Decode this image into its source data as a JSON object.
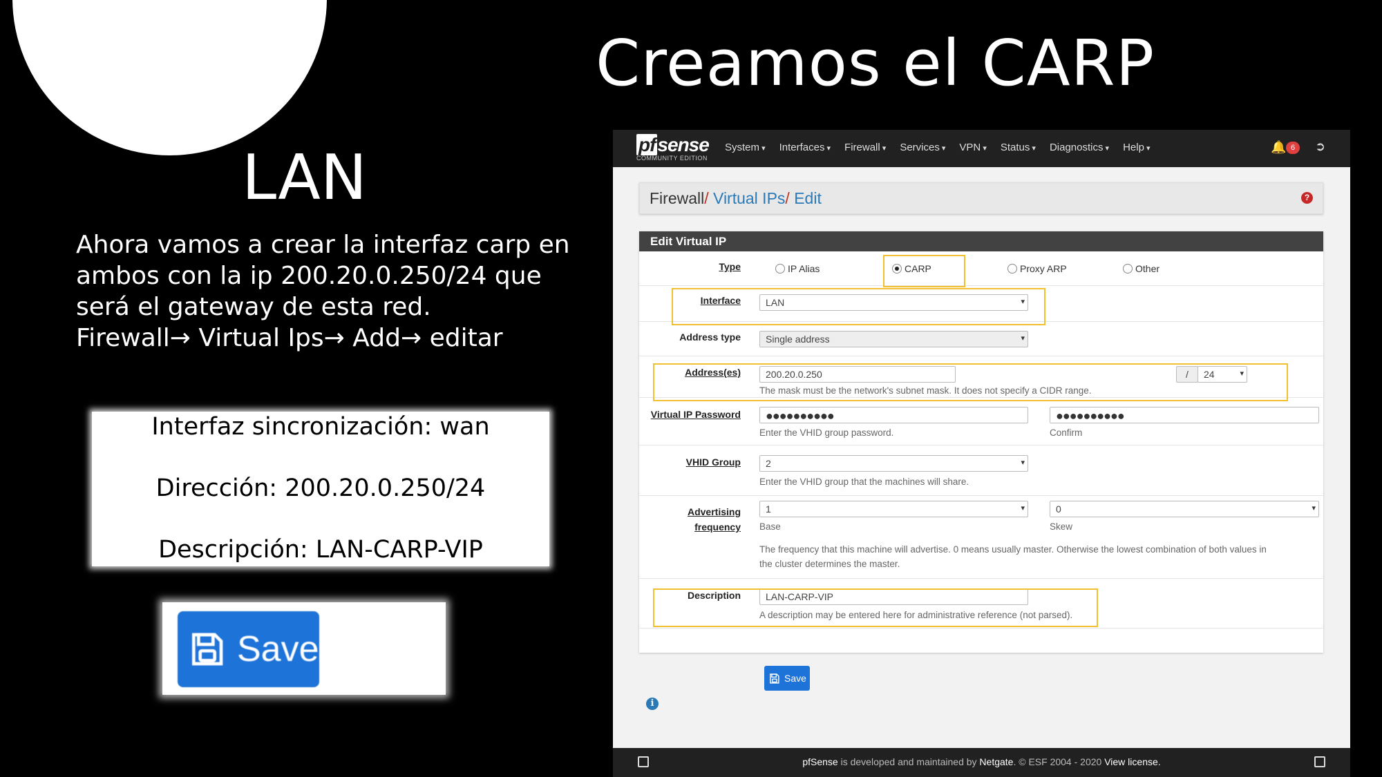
{
  "slide": {
    "title": "Creamos el CARP",
    "heading": "LAN",
    "body_lines": [
      "Ahora vamos a crear la interfaz carp en",
      "ambos con la ip 200.20.0.250/24 que",
      "será el gateway de esta red.",
      "Firewall→ Virtual Ips→ Add→ editar"
    ],
    "box_lines": [
      "Interfaz sincronización: wan",
      "Dirección: 200.20.0.250/24",
      "Descripción: LAN-CARP-VIP"
    ],
    "save_zoom_label": "Save"
  },
  "pfsense": {
    "logo": {
      "brand_pf": "pf",
      "brand_rest": "sense",
      "edition": "COMMUNITY EDITION"
    },
    "nav": [
      "System",
      "Interfaces",
      "Firewall",
      "Services",
      "VPN",
      "Status",
      "Diagnostics",
      "Help"
    ],
    "notification_count": "6",
    "breadcrumb": {
      "root": "Firewall",
      "sep": "/",
      "link1": "Virtual IPs",
      "link2": "Edit",
      "help": "?"
    },
    "panel_title": "Edit Virtual IP",
    "form": {
      "type": {
        "label": "Type",
        "options": [
          "IP Alias",
          "CARP",
          "Proxy ARP",
          "Other"
        ],
        "selected": "CARP"
      },
      "interface": {
        "label": "Interface",
        "value": "LAN"
      },
      "address_type": {
        "label": "Address type",
        "value": "Single address"
      },
      "addresses": {
        "label": "Address(es)",
        "value": "200.20.0.250",
        "slash": "/",
        "mask": "24",
        "help": "The mask must be the network's subnet mask. It does not specify a CIDR range."
      },
      "password": {
        "label": "Virtual IP Password",
        "value": "●●●●●●●●●●",
        "help": "Enter the VHID group password.",
        "confirm_value": "●●●●●●●●●●",
        "confirm_help": "Confirm"
      },
      "vhid": {
        "label": "VHID Group",
        "value": "2",
        "help": "Enter the VHID group that the machines will share."
      },
      "advertising": {
        "label_line1": "Advertising",
        "label_line2": "frequency",
        "base_value": "1",
        "base_help": "Base",
        "skew_value": "0",
        "skew_help": "Skew",
        "help_line1": "The frequency that this machine will advertise. 0 means usually master. Otherwise the lowest combination of both values in",
        "help_line2": "the cluster determines the master."
      },
      "description": {
        "label": "Description",
        "value": "LAN-CARP-VIP",
        "help": "A description may be entered here for administrative reference (not parsed)."
      }
    },
    "save_label": "Save",
    "info_icon": "i",
    "footer": {
      "brand": "pfSense",
      "text1": " is developed and maintained by ",
      "company": "Netgate",
      "text2": ". © ESF 2004 - 2020 ",
      "license": "View license."
    }
  },
  "colors": {
    "highlight": "#f0c030",
    "save_button": "#1e73d8",
    "navbar": "#212121",
    "panel_head": "#424242"
  }
}
